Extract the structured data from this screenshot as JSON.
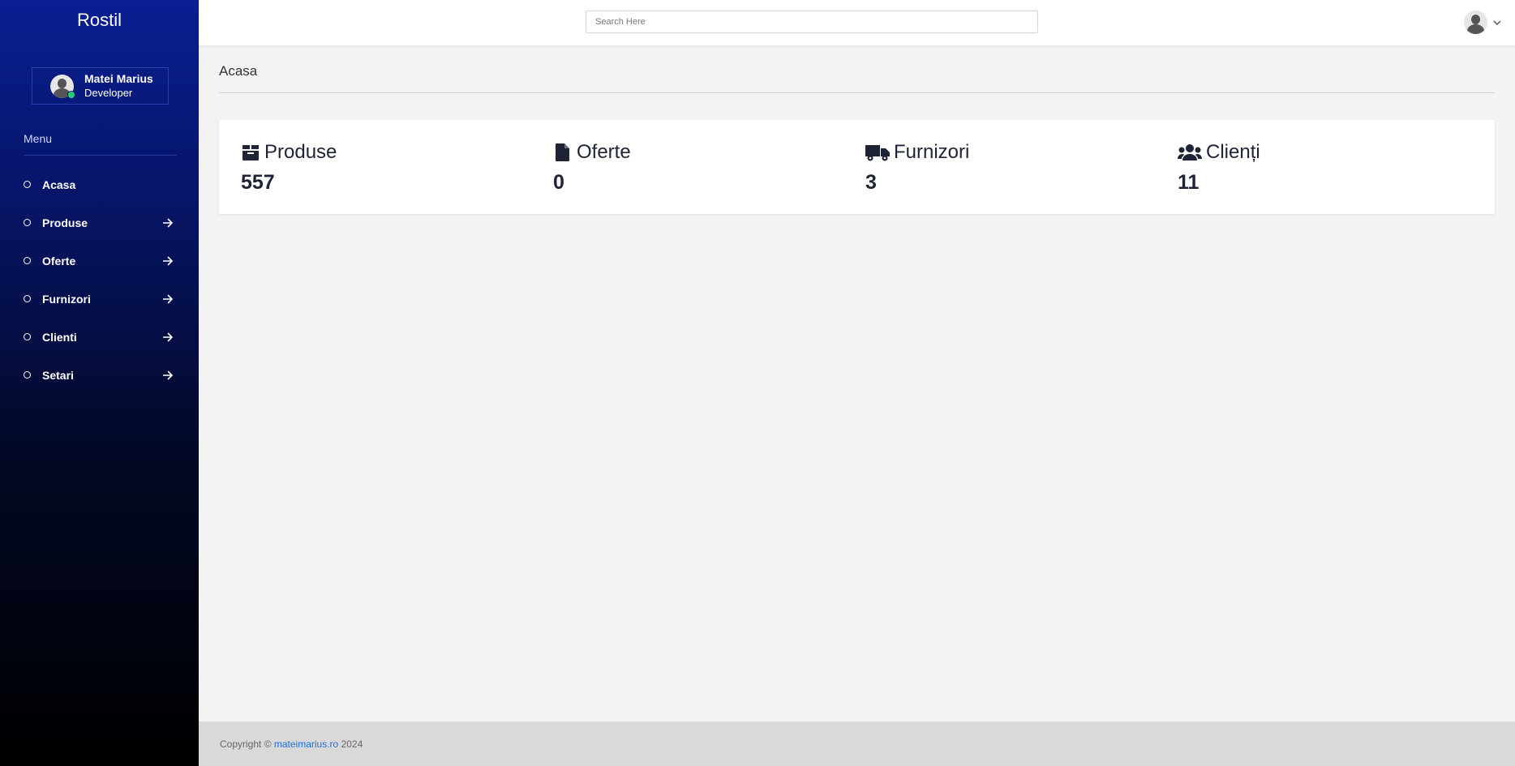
{
  "brand": "Rostil",
  "user": {
    "name": "Matei Marius",
    "role": "Developer"
  },
  "menu": {
    "title": "Menu",
    "items": [
      {
        "label": "Acasa",
        "has_arrow": false
      },
      {
        "label": "Produse",
        "has_arrow": true
      },
      {
        "label": "Oferte",
        "has_arrow": true
      },
      {
        "label": "Furnizori",
        "has_arrow": true
      },
      {
        "label": "Clienti",
        "has_arrow": true
      },
      {
        "label": "Setari",
        "has_arrow": true
      }
    ]
  },
  "header": {
    "search_placeholder": "Search Here"
  },
  "page": {
    "title": "Acasa"
  },
  "stats": [
    {
      "icon": "box-icon",
      "label": "Produse",
      "value": "557"
    },
    {
      "icon": "file-icon",
      "label": "Oferte",
      "value": "0"
    },
    {
      "icon": "truck-icon",
      "label": "Furnizori",
      "value": "3"
    },
    {
      "icon": "users-icon",
      "label": "Clienți",
      "value": "11"
    }
  ],
  "footer": {
    "prefix": "Copyright © ",
    "link_text": "mateimarius.ro",
    "suffix": " 2024"
  },
  "colors": {
    "sidebar_top": "#0a1f93",
    "sidebar_bottom": "#000000",
    "online": "#2ecc71",
    "link": "#1a6fd8",
    "text_dark": "#1e2336"
  }
}
